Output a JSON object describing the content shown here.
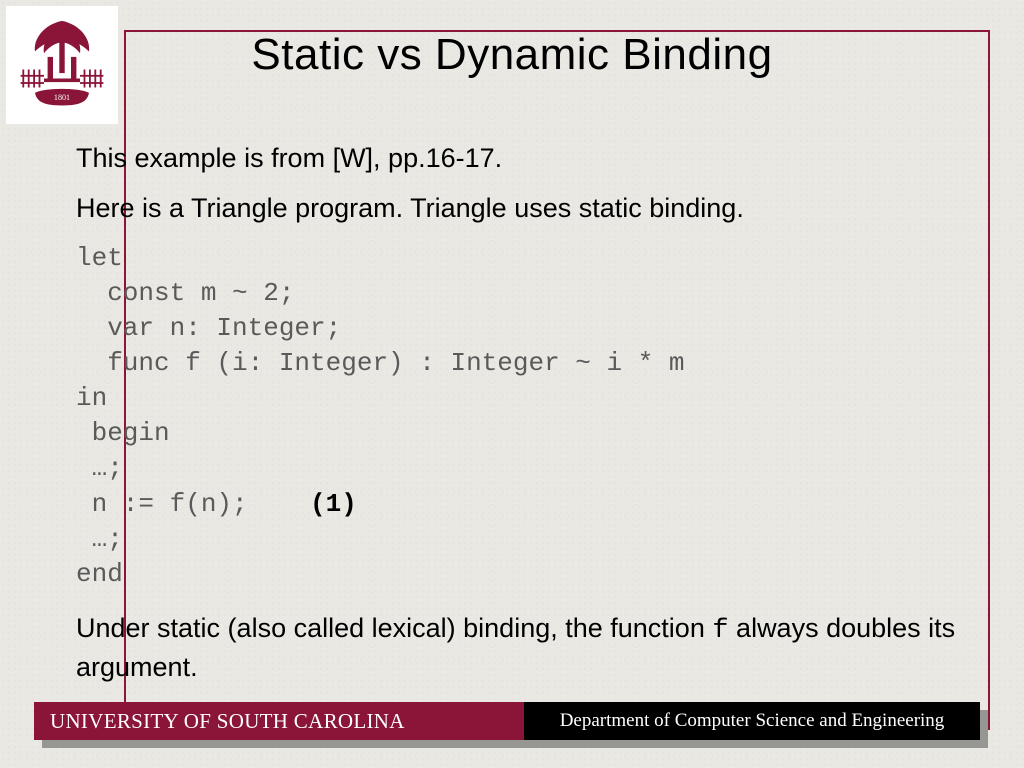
{
  "title": "Static vs Dynamic Binding",
  "para1": "This example is from [W], pp.16-17.",
  "para2": "Here is a Triangle program. Triangle uses static binding.",
  "code": {
    "l1": "let",
    "l2": "  const m ~ 2;",
    "l3": "  var n: Integer;",
    "l4": "  func f (i: Integer) : Integer ~ i * m",
    "l5": "in",
    "l6": " begin",
    "l7": " …;",
    "l8a": " n := f(n);    ",
    "l8b": "(1)",
    "l9": " …;",
    "l10": "end"
  },
  "para3a": "Under static (also called lexical) binding, the function ",
  "para3b": "f",
  "para3c": " always doubles its argument.",
  "footer": {
    "university": "UNIVERSITY OF SOUTH CAROLINA",
    "department": "Department of Computer Science and Engineering"
  },
  "colors": {
    "accent": "#8a1538"
  }
}
